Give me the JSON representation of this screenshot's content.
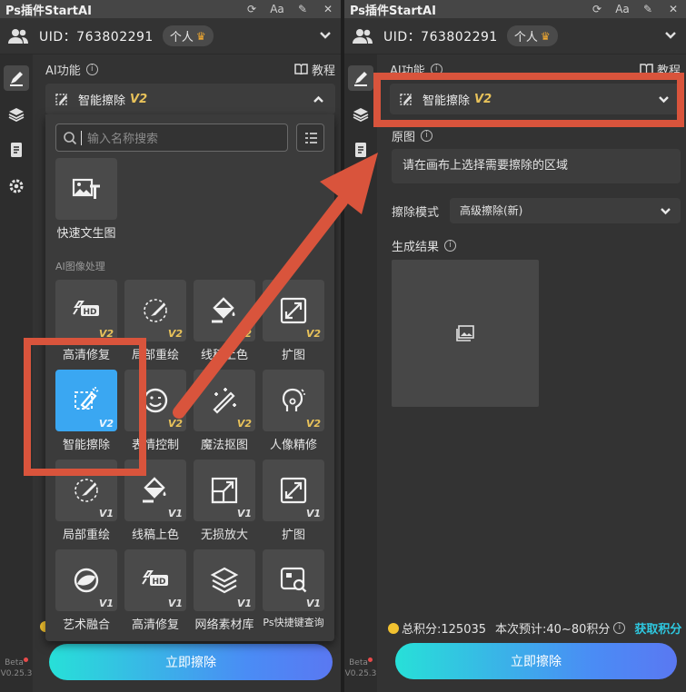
{
  "app": {
    "title": "Ps插件StartAI",
    "uid_text": "UID：763802291",
    "plan_badge": "个人",
    "beta_label": "Beta",
    "version": "V0.25.3"
  },
  "ai_function": {
    "heading": "AI功能",
    "info_glyph": "i",
    "tutorial_label": "教程",
    "selected_tool": "智能擦除",
    "selected_version": "V2"
  },
  "dropdown": {
    "search_placeholder": "输入名称搜索",
    "top_tiles": [
      {
        "label": "快速文生图",
        "icon": "text-to-image-icon",
        "version": ""
      }
    ],
    "group_title": "AI图像处理",
    "tiles": [
      {
        "label": "高清修复",
        "icon": "hd-icon",
        "version": "V2",
        "selected": false
      },
      {
        "label": "局部重绘",
        "icon": "brush-icon",
        "version": "V2",
        "selected": false
      },
      {
        "label": "线稿上色",
        "icon": "paint-bucket-icon",
        "version": "V2",
        "selected": false
      },
      {
        "label": "扩图",
        "icon": "expand-icon",
        "version": "V2",
        "selected": false
      },
      {
        "label": "智能擦除",
        "icon": "eraser-icon",
        "version": "V2",
        "selected": true
      },
      {
        "label": "表情控制",
        "icon": "smile-icon",
        "version": "V2",
        "selected": false
      },
      {
        "label": "魔法抠图",
        "icon": "magic-wand-icon",
        "version": "V2",
        "selected": false
      },
      {
        "label": "人像精修",
        "icon": "portrait-icon",
        "version": "V2",
        "selected": false
      },
      {
        "label": "局部重绘",
        "icon": "brush-icon",
        "version": "V1",
        "selected": false
      },
      {
        "label": "线稿上色",
        "icon": "paint-bucket-icon",
        "version": "V1",
        "selected": false
      },
      {
        "label": "无损放大",
        "icon": "upscale-icon",
        "version": "V1",
        "selected": false
      },
      {
        "label": "扩图",
        "icon": "expand-icon",
        "version": "V1",
        "selected": false
      },
      {
        "label": "艺术融合",
        "icon": "blend-icon",
        "version": "V1",
        "selected": false
      },
      {
        "label": "高清修复",
        "icon": "hd-icon",
        "version": "V1",
        "selected": false
      },
      {
        "label": "网络素材库",
        "icon": "layers-icon",
        "version": "V1",
        "selected": false
      },
      {
        "label": "Ps快捷键查询",
        "icon": "shortcut-search-icon",
        "version": "V1",
        "selected": false
      }
    ]
  },
  "erase_panel": {
    "source_label": "原图",
    "source_hint": "请在画布上选择需要擦除的区域",
    "mode_label": "擦除模式",
    "mode_value": "高级擦除(新)",
    "result_label": "生成结果"
  },
  "points": {
    "total": "总积分:125035",
    "estimate": "本次预计:40~80积分",
    "get_link": "获取积分"
  },
  "submit_label": "立即擦除",
  "colors": {
    "annotation_red": "#d9543c",
    "selected_tile": "#3aa7f2",
    "v2_gold": "#e8c25a",
    "link_cyan": "#2ec8e0"
  }
}
